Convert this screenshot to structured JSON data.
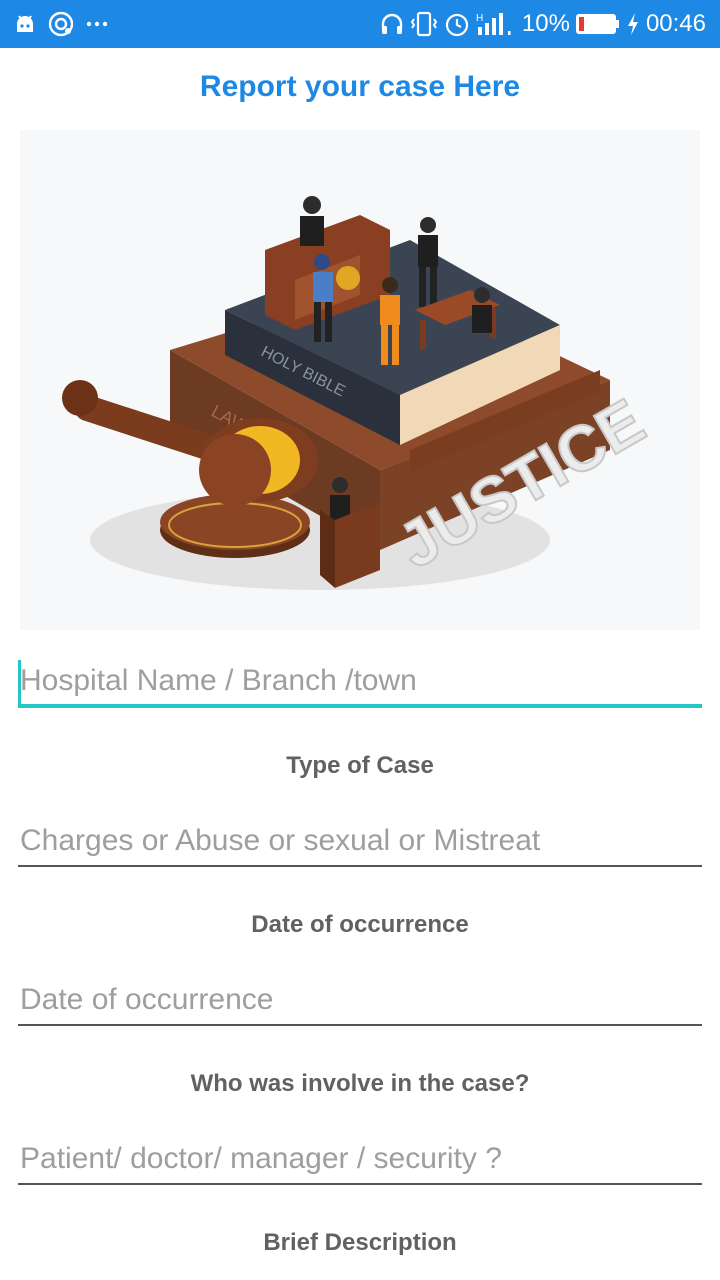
{
  "status_bar": {
    "battery_percent": "10%",
    "time": "00:46",
    "network_type": "H",
    "icons": [
      "android-icon",
      "sync-icon",
      "more-icon",
      "headphones-icon",
      "vibrate-icon",
      "alarm-icon",
      "signal-icon",
      "battery-icon",
      "charging-icon"
    ]
  },
  "header": {
    "title": "Report your case Here"
  },
  "illustration": {
    "name": "justice-court-illustration",
    "text": {
      "justice": "JUSTICE",
      "holy_bible": "HOLY BIBLE",
      "law": "LAW"
    }
  },
  "form": {
    "hospital": {
      "placeholder": "Hospital Name / Branch /town",
      "value": ""
    },
    "type_label": "Type of Case",
    "type_field": {
      "placeholder": "Charges or Abuse or sexual or Mistreat",
      "value": ""
    },
    "date_label": "Date of occurrence",
    "date_field": {
      "placeholder": "Date of occurrence",
      "value": ""
    },
    "involved_label": "Who was involve in the case?",
    "involved_field": {
      "placeholder": "Patient/ doctor/ manager / security ?",
      "value": ""
    },
    "description_label": "Brief Description"
  },
  "colors": {
    "primary": "#1e88e5",
    "accent": "#26c6c6",
    "label": "#616161",
    "placeholder": "#9e9e9e"
  }
}
